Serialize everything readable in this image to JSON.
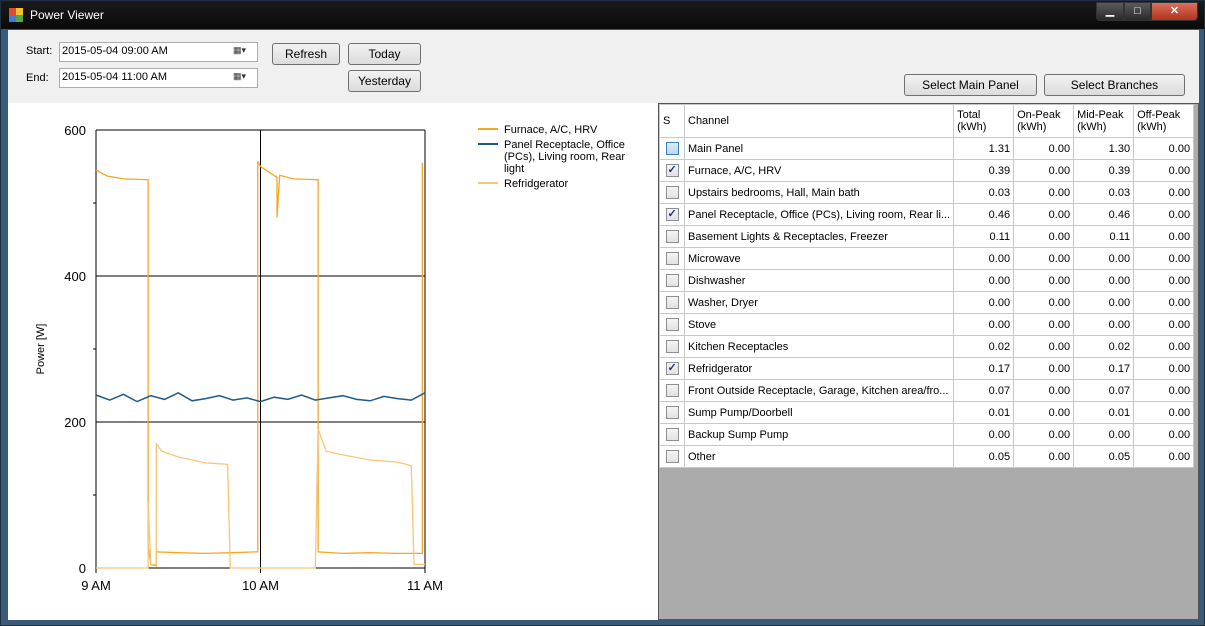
{
  "window": {
    "title": "Power Viewer",
    "min_label": "▁",
    "max_label": "□",
    "close_label": "✕"
  },
  "toolbar": {
    "start_label": "Start:",
    "end_label": "End:",
    "start_value": "2015-05-04 09:00 AM",
    "end_value": "2015-05-04 11:00 AM",
    "refresh_label": "Refresh",
    "today_label": "Today",
    "yesterday_label": "Yesterday",
    "select_main_label": "Select Main Panel",
    "select_branches_label": "Select Branches"
  },
  "chart_data": {
    "type": "line",
    "title": "",
    "xlabel": "",
    "ylabel": "Power [W]",
    "x_ticks": [
      "9 AM",
      "10 AM",
      "11 AM"
    ],
    "y_ticks": [
      "0",
      "200",
      "400",
      "600"
    ],
    "xlim": [
      "2015-05-04 09:00",
      "2015-05-04 11:00"
    ],
    "ylim": [
      0,
      600
    ],
    "grid": true,
    "legend_position": "top-right",
    "series": [
      {
        "name": "Furnace, A/C, HRV",
        "color": "#f5a623",
        "points": [
          [
            "09:00",
            545
          ],
          [
            "09:04",
            537
          ],
          [
            "09:10",
            533
          ],
          [
            "09:18",
            532
          ],
          [
            "09:19",
            532
          ],
          [
            "09:19",
            30
          ],
          [
            "09:20",
            5
          ],
          [
            "09:22",
            3
          ],
          [
            "09:22",
            22
          ],
          [
            "09:30",
            21
          ],
          [
            "09:40",
            20
          ],
          [
            "09:50",
            21
          ],
          [
            "09:58",
            22
          ],
          [
            "09:59",
            22
          ],
          [
            "09:59",
            557
          ],
          [
            "10:00",
            550
          ],
          [
            "10:04",
            540
          ],
          [
            "10:06",
            535
          ],
          [
            "10:06",
            480
          ],
          [
            "10:07",
            538
          ],
          [
            "10:12",
            533
          ],
          [
            "10:20",
            532
          ],
          [
            "10:21",
            532
          ],
          [
            "10:21",
            22
          ],
          [
            "10:30",
            20
          ],
          [
            "10:40",
            21
          ],
          [
            "10:50",
            20
          ],
          [
            "10:59",
            20
          ],
          [
            "10:59",
            555
          ]
        ]
      },
      {
        "name": "Panel Receptacle, Office (PCs), Living room, Rear light",
        "color": "#1f5a8a",
        "points": [
          [
            "09:00",
            237
          ],
          [
            "09:05",
            230
          ],
          [
            "09:10",
            238
          ],
          [
            "09:15",
            228
          ],
          [
            "09:20",
            236
          ],
          [
            "09:25",
            231
          ],
          [
            "09:30",
            240
          ],
          [
            "09:35",
            229
          ],
          [
            "09:40",
            232
          ],
          [
            "09:45",
            236
          ],
          [
            "09:50",
            230
          ],
          [
            "09:55",
            233
          ],
          [
            "10:00",
            228
          ],
          [
            "10:05",
            234
          ],
          [
            "10:10",
            231
          ],
          [
            "10:15",
            237
          ],
          [
            "10:20",
            230
          ],
          [
            "10:25",
            233
          ],
          [
            "10:30",
            236
          ],
          [
            "10:35",
            231
          ],
          [
            "10:40",
            229
          ],
          [
            "10:45",
            235
          ],
          [
            "10:50",
            232
          ],
          [
            "10:55",
            230
          ],
          [
            "11:00",
            240
          ]
        ]
      },
      {
        "name": "Refridgerator",
        "color": "#f8c677",
        "points": [
          [
            "09:00",
            0
          ],
          [
            "09:19",
            0
          ],
          [
            "09:19",
            90
          ],
          [
            "09:20",
            5
          ],
          [
            "09:22",
            5
          ],
          [
            "09:22",
            170
          ],
          [
            "09:24",
            160
          ],
          [
            "09:30",
            152
          ],
          [
            "09:40",
            144
          ],
          [
            "09:48",
            142
          ],
          [
            "09:49",
            0
          ],
          [
            "10:00",
            0
          ],
          [
            "10:20",
            0
          ],
          [
            "10:21",
            190
          ],
          [
            "10:24",
            160
          ],
          [
            "10:30",
            155
          ],
          [
            "10:40",
            148
          ],
          [
            "10:50",
            145
          ],
          [
            "10:55",
            140
          ],
          [
            "10:56",
            5
          ],
          [
            "11:00",
            5
          ]
        ]
      }
    ]
  },
  "grid": {
    "headers": [
      "S",
      "Channel",
      "Total (kWh)",
      "On-Peak (kWh)",
      "Mid-Peak (kWh)",
      "Off-Peak (kWh)"
    ],
    "rows": [
      {
        "checked": false,
        "highlight": true,
        "channel": "Main Panel",
        "total": "1.31",
        "on": "0.00",
        "mid": "1.30",
        "off": "0.00"
      },
      {
        "checked": true,
        "highlight": false,
        "channel": "Furnace, A/C, HRV",
        "total": "0.39",
        "on": "0.00",
        "mid": "0.39",
        "off": "0.00"
      },
      {
        "checked": false,
        "highlight": false,
        "channel": "Upstairs bedrooms, Hall, Main bath",
        "total": "0.03",
        "on": "0.00",
        "mid": "0.03",
        "off": "0.00"
      },
      {
        "checked": true,
        "highlight": false,
        "channel": "Panel Receptacle, Office (PCs), Living room, Rear li...",
        "total": "0.46",
        "on": "0.00",
        "mid": "0.46",
        "off": "0.00"
      },
      {
        "checked": false,
        "highlight": false,
        "channel": "Basement Lights & Receptacles, Freezer",
        "total": "0.11",
        "on": "0.00",
        "mid": "0.11",
        "off": "0.00"
      },
      {
        "checked": false,
        "highlight": false,
        "channel": "Microwave",
        "total": "0.00",
        "on": "0.00",
        "mid": "0.00",
        "off": "0.00"
      },
      {
        "checked": false,
        "highlight": false,
        "channel": "Dishwasher",
        "total": "0.00",
        "on": "0.00",
        "mid": "0.00",
        "off": "0.00"
      },
      {
        "checked": false,
        "highlight": false,
        "channel": "Washer, Dryer",
        "total": "0.00",
        "on": "0.00",
        "mid": "0.00",
        "off": "0.00"
      },
      {
        "checked": false,
        "highlight": false,
        "channel": "Stove",
        "total": "0.00",
        "on": "0.00",
        "mid": "0.00",
        "off": "0.00"
      },
      {
        "checked": false,
        "highlight": false,
        "channel": "Kitchen Receptacles",
        "total": "0.02",
        "on": "0.00",
        "mid": "0.02",
        "off": "0.00"
      },
      {
        "checked": true,
        "highlight": false,
        "channel": "Refridgerator",
        "total": "0.17",
        "on": "0.00",
        "mid": "0.17",
        "off": "0.00"
      },
      {
        "checked": false,
        "highlight": false,
        "channel": "Front Outside Receptacle, Garage, Kitchen area/fro...",
        "total": "0.07",
        "on": "0.00",
        "mid": "0.07",
        "off": "0.00"
      },
      {
        "checked": false,
        "highlight": false,
        "channel": "Sump Pump/Doorbell",
        "total": "0.01",
        "on": "0.00",
        "mid": "0.01",
        "off": "0.00"
      },
      {
        "checked": false,
        "highlight": false,
        "channel": "Backup Sump Pump",
        "total": "0.00",
        "on": "0.00",
        "mid": "0.00",
        "off": "0.00"
      },
      {
        "checked": false,
        "highlight": false,
        "channel": "Other",
        "total": "0.05",
        "on": "0.00",
        "mid": "0.05",
        "off": "0.00"
      }
    ]
  }
}
